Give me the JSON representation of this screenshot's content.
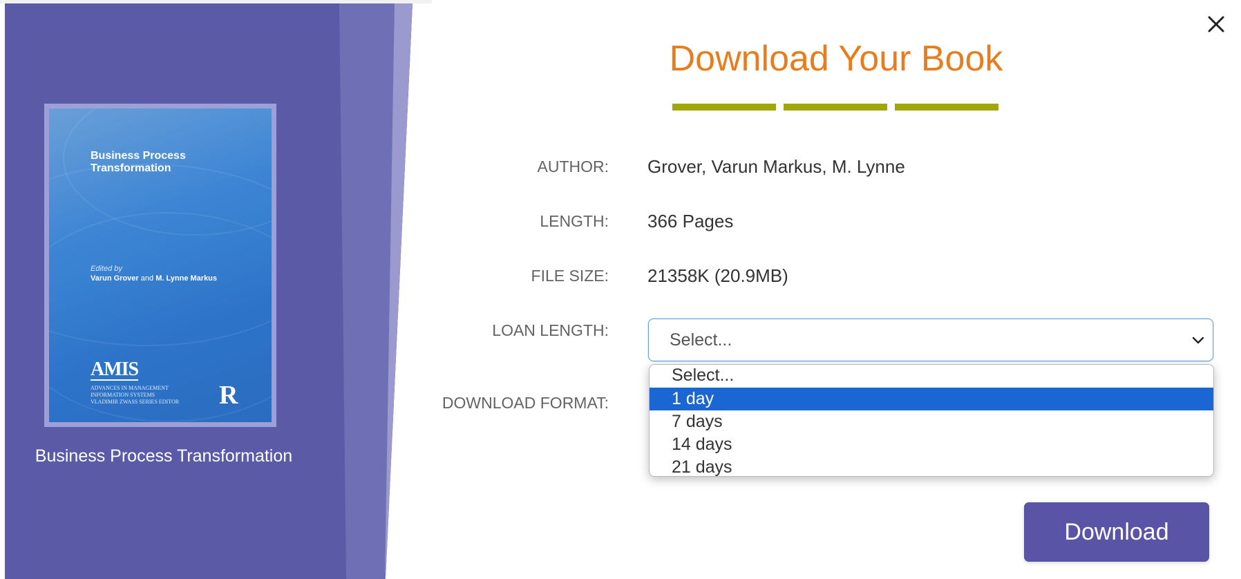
{
  "book": {
    "title": "Business Process Transformation",
    "cover": {
      "title": "Business Process Transformation",
      "edited_by": "Edited by",
      "editors_part1": "Varun Grover",
      "editors_and": "and",
      "editors_part2": "M. Lynne Markus",
      "series_logo": "AMIS",
      "series_line1": "ADVANCES IN MANAGEMENT",
      "series_line2": "INFORMATION SYSTEMS",
      "series_line3": "VLADIMIR ZWASS SERIES EDITOR",
      "publisher_logo": "R"
    }
  },
  "modal": {
    "heading": "Download Your Book",
    "close_icon": "close-icon",
    "fields": {
      "author_label": "AUTHOR:",
      "author_value": "Grover, Varun Markus, M. Lynne",
      "length_label": "LENGTH:",
      "length_value": "366 Pages",
      "file_size_label": "FILE SIZE:",
      "file_size_value": "21358K (20.9MB)",
      "loan_length_label": "LOAN LENGTH:",
      "download_format_label": "DOWNLOAD FORMAT:"
    },
    "loan_select": {
      "value": "Select...",
      "options": [
        "Select...",
        "1 day",
        "7 days",
        "14 days",
        "21 days"
      ],
      "highlighted": "1 day"
    },
    "download_button": "Download"
  },
  "colors": {
    "panel": "#5a5aa6",
    "heading": "#e87d1e",
    "divider": "#a1a70a",
    "highlight": "#1a66d2",
    "button": "#5a54a6"
  }
}
